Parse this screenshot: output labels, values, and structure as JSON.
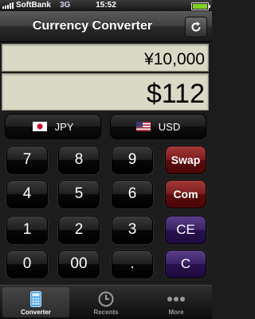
{
  "status": {
    "carrier": "SoftBank",
    "network": "3G",
    "time": "15:52"
  },
  "navbar": {
    "title": "Currency Converter",
    "refresh_icon": "refresh-icon"
  },
  "display": {
    "source_amount": "¥10,000",
    "converted_amount": "$112"
  },
  "currencies": {
    "from": {
      "code": "JPY",
      "flag_icon": "japan-flag-icon"
    },
    "to": {
      "code": "USD",
      "flag_icon": "us-flag-icon"
    }
  },
  "keypad": {
    "digits": [
      "7",
      "8",
      "9",
      "4",
      "5",
      "6",
      "1",
      "2",
      "3",
      "0",
      "00",
      "."
    ],
    "swap": "Swap",
    "com": "Com",
    "ce": "CE",
    "c": "C"
  },
  "tabs": [
    {
      "label": "Converter",
      "icon": "calculator-icon",
      "active": true
    },
    {
      "label": "Recents",
      "icon": "clock-icon",
      "active": false
    },
    {
      "label": "More",
      "icon": "more-dots-icon",
      "active": false
    }
  ],
  "colors": {
    "display_bg": "#d9d9c6",
    "swap_com": "#7a1c1c",
    "ce_c": "#3a2266"
  }
}
